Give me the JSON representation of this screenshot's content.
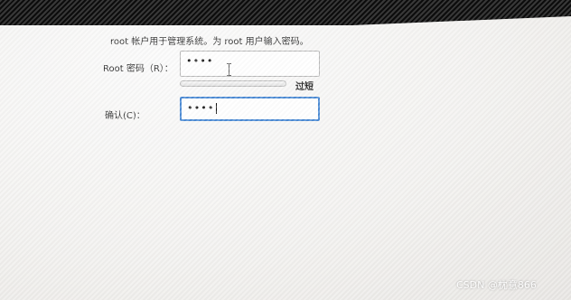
{
  "description": "root 帐户用于管理系统。为 root 用户输入密码。",
  "root_password": {
    "label": "Root 密码（R）：",
    "masked_value": "••••"
  },
  "strength": {
    "text": "过短",
    "level": 0,
    "bar_color": "#cc3b3b"
  },
  "confirm": {
    "label": "确认(C)：",
    "masked_value": "••••"
  },
  "focus_color": "#4a8ad4",
  "watermark": "CSDN @枕意866"
}
